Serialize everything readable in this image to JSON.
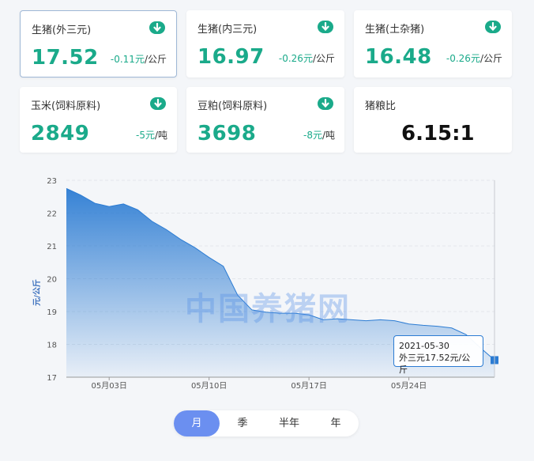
{
  "cards": [
    {
      "title": "生猪(外三元)",
      "price": "17.52",
      "change": "-0.11元",
      "unit": "/公斤",
      "icon": "down-arrow-icon"
    },
    {
      "title": "生猪(内三元)",
      "price": "16.97",
      "change": "-0.26元",
      "unit": "/公斤",
      "icon": "down-arrow-icon"
    },
    {
      "title": "生猪(土杂猪)",
      "price": "16.48",
      "change": "-0.26元",
      "unit": "/公斤",
      "icon": "down-arrow-icon"
    },
    {
      "title": "玉米(饲料原料)",
      "price": "2849",
      "change": "-5元",
      "unit": "/吨",
      "icon": "down-arrow-icon"
    },
    {
      "title": "豆粕(饲料原料)",
      "price": "3698",
      "change": "-8元",
      "unit": "/吨",
      "icon": "down-arrow-icon"
    }
  ],
  "ratio": {
    "title": "猪粮比",
    "value": "6.15:1"
  },
  "colors": {
    "accent": "#1aaa8a",
    "line": "#2c7cd3",
    "active_tab": "#6b8ff0"
  },
  "chart_data": {
    "type": "area",
    "ylabel": "元/公斤",
    "ylim": [
      17,
      23
    ],
    "yticks": [
      17,
      18,
      19,
      20,
      21,
      22,
      23
    ],
    "x_tick_labels": [
      "05月03日",
      "05月10日",
      "05月17日",
      "05月24日"
    ],
    "x": [
      "04-30",
      "05-01",
      "05-02",
      "05-03",
      "05-04",
      "05-05",
      "05-06",
      "05-07",
      "05-08",
      "05-09",
      "05-10",
      "05-11",
      "05-12",
      "05-13",
      "05-14",
      "05-15",
      "05-16",
      "05-17",
      "05-18",
      "05-19",
      "05-20",
      "05-21",
      "05-22",
      "05-23",
      "05-24",
      "05-25",
      "05-26",
      "05-27",
      "05-28",
      "05-29",
      "05-30"
    ],
    "series": [
      {
        "values": [
          22.75,
          22.55,
          22.3,
          22.2,
          22.28,
          22.1,
          21.75,
          21.5,
          21.2,
          20.95,
          20.65,
          20.38,
          19.5,
          19.05,
          18.98,
          18.95,
          18.95,
          18.9,
          18.75,
          18.78,
          18.75,
          18.72,
          18.75,
          18.72,
          18.62,
          18.58,
          18.55,
          18.5,
          18.3,
          17.9,
          17.52
        ]
      }
    ],
    "grid": true,
    "watermark": "中国养猪网",
    "tooltip": {
      "date": "2021-05-30",
      "text": "外三元17.52元/公斤"
    }
  },
  "range_tabs": [
    {
      "label": "月",
      "active": true
    },
    {
      "label": "季",
      "active": false
    },
    {
      "label": "半年",
      "active": false
    },
    {
      "label": "年",
      "active": false
    }
  ]
}
